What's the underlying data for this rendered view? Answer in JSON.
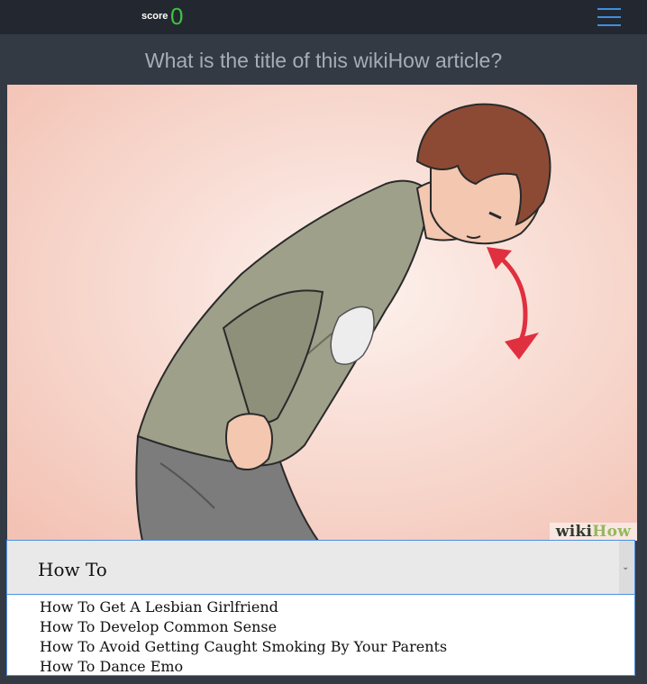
{
  "header": {
    "score_label": "score",
    "score_value": "0",
    "menu_icon": "hamburger-menu-icon",
    "accent_color": "#3d8fe0",
    "score_color": "#3fc23f"
  },
  "question": "What is the title of this wikiHow article?",
  "image": {
    "description_icon": "wikihow-illustration",
    "watermark_part1": "wiki",
    "watermark_part2": "How"
  },
  "select": {
    "selected_value": "How To",
    "options": [
      "How To Get A Lesbian Girlfriend",
      "How To Develop Common Sense",
      "How To Avoid Getting Caught Smoking By Your Parents",
      "How To Dance Emo"
    ]
  }
}
